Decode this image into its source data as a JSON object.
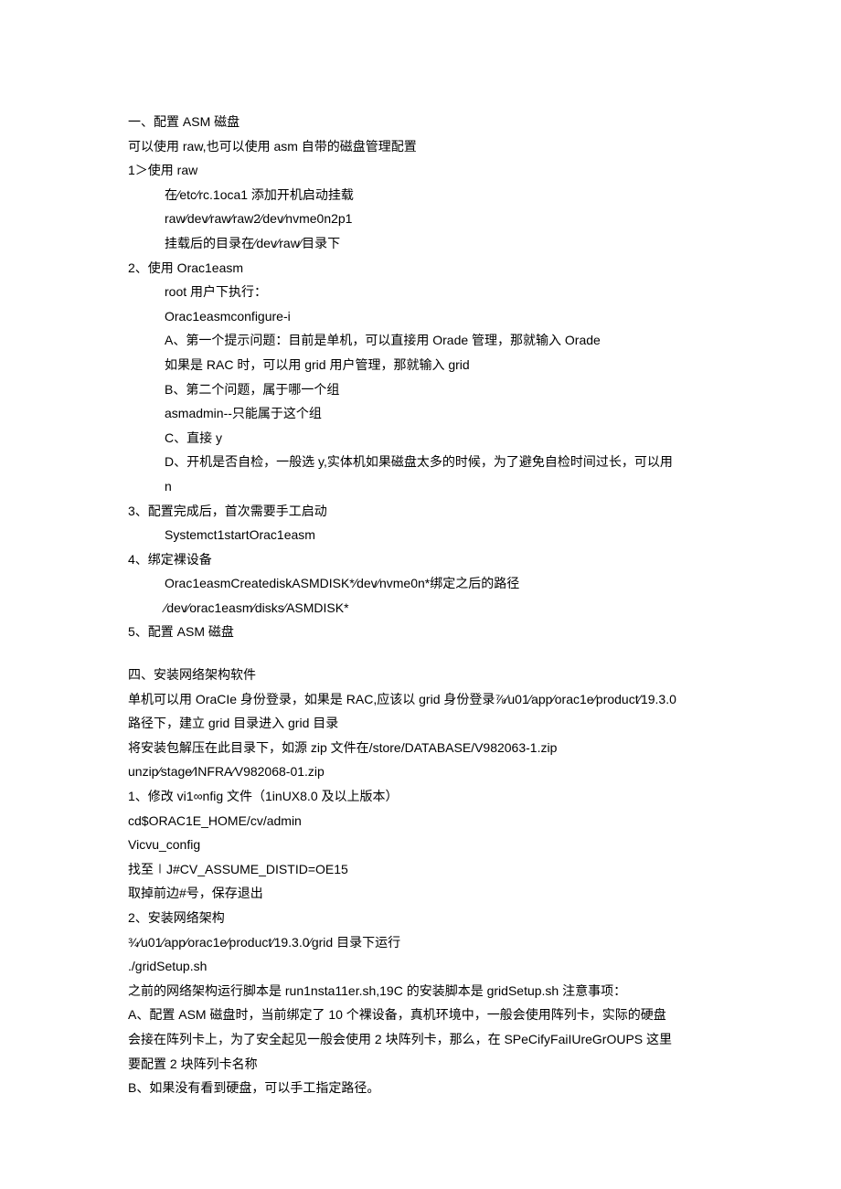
{
  "section1": {
    "title": "一、配置 ASM 磁盘",
    "intro1": "可以使用 raw,也可以使用 asm 自带的磁盘管理配置",
    "step1_title": "1＞使用 raw",
    "step1_line1": "在∕etc∕rc.1oca1 添加开机启动挂载",
    "step1_line2": "raw∕dev∕raw∕raw2∕dev∕nvme0n2p1",
    "step1_line3": "挂载后的目录在∕dev∕raw∕目录下",
    "step2_title": "2、使用 Orac1easm",
    "step2_line1": "root 用户下执行：",
    "step2_line2": "Orac1easmconfigure-i",
    "step2_line3": "A、第一个提示问题：目前是单机，可以直接用 Orade 管理，那就输入 Orade",
    "step2_line4": "如果是 RAC 时，可以用 grid 用户管理，那就输入 grid",
    "step2_line5": "B、第二个问题，属于哪一个组",
    "step2_line6": "asmadmin--只能属于这个组",
    "step2_line7": "C、直接 y",
    "step2_line8": "D、开机是否自检，一般选 y,实体机如果磁盘太多的时候，为了避免自检时间过长，可以用",
    "step2_line9": "n",
    "step3_title": "3、配置完成后，首次需要手工启动",
    "step3_line1": "Systemct1startOrac1easm",
    "step4_title": "4、绑定裸设备",
    "step4_line1": "Orac1easmCreatediskASMDISK*∕dev∕nvme0n*绑定之后的路径",
    "step4_line2": "∕dev∕orac1easm∕disks∕ASMDISK*",
    "step5_title": "5、配置 ASM 磁盘"
  },
  "section4": {
    "title": "四、安装网络架构软件",
    "line1": "单机可以用 OraCIe 身份登录，如果是 RAC,应该以 grid 身份登录⅞∕u01∕app∕orac1e∕product∕19.3.0",
    "line2": "路径下，建立 grid 目录进入 grid 目录",
    "line3": "将安装包解压在此目录下，如源 zip 文件在/store/DATABASE/V982063-1.zip",
    "line4": "unzip∕stage∕INFRA∕V982068-01.zip",
    "step1_title": "1、修改 vi1∞nfig 文件（1inUX8.0 及以上版本）",
    "step1_line1": "cd$ORAC1E_HOME/cv/admin",
    "step1_line2": "Vicvu_config",
    "step1_line3": "找至∣J#CV_ASSUME_DISTID=OE15",
    "step1_line4": "取掉前边#号，保存退出",
    "step2_title": "2、安装网络架构",
    "step2_line1": "¾∕u01∕app∕orac1e∕product∕19.3.0∕grid 目录下运行",
    "step2_line2": "./gridSetup.sh",
    "step2_line3": "之前的网络架构运行脚本是 run1nsta11er.sh,19C 的安装脚本是 gridSetup.sh 注意事项：",
    "step2_line4": "A、配置 ASM 磁盘时，当前绑定了 10 个裸设备，真机环境中，一般会使用阵列卡，实际的硬盘",
    "step2_line5": "会接在阵列卡上，为了安全起见一般会使用 2 块阵列卡，那么，在 SPeCifyFaiIUreGrOUPS 这里",
    "step2_line6": "要配置 2 块阵列卡名称",
    "step2_line7": "B、如果没有看到硬盘，可以手工指定路径。"
  }
}
